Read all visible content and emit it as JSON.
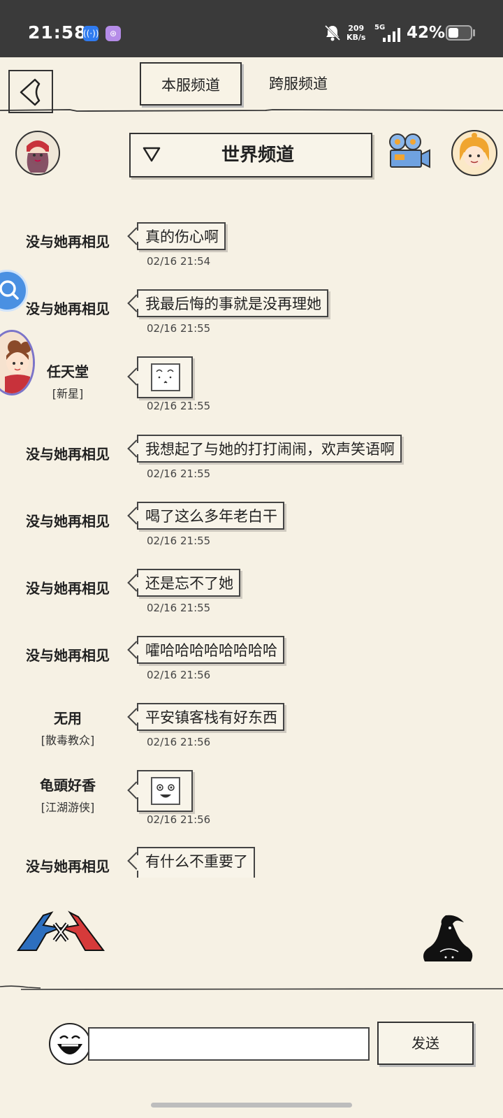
{
  "status_bar": {
    "time": "21:58",
    "net_speed_value": "209",
    "net_speed_unit": "KB/s",
    "network": "5G",
    "battery": "42%"
  },
  "tabs": [
    {
      "label": "本服频道",
      "active": true
    },
    {
      "label": "跨服频道",
      "active": false
    }
  ],
  "channel": {
    "label": "世界频道"
  },
  "messages": [
    {
      "sender": "没与她再相见",
      "title": "",
      "text": "真的伤心啊",
      "time": "02/16 21:54"
    },
    {
      "sender": "没与她再相见",
      "title": "",
      "text": "我最后悔的事就是没再理她",
      "time": "02/16 21:55"
    },
    {
      "sender": "任天堂",
      "title": "[新星]",
      "emoji": "face-1",
      "time": "02/16 21:55"
    },
    {
      "sender": "没与她再相见",
      "title": "",
      "text": "我想起了与她的打打闹闹，欢声笑语啊",
      "time": "02/16 21:55"
    },
    {
      "sender": "没与她再相见",
      "title": "",
      "text": "喝了这么多年老白干",
      "time": "02/16 21:55"
    },
    {
      "sender": "没与她再相见",
      "title": "",
      "text": "还是忘不了她",
      "time": "02/16 21:55"
    },
    {
      "sender": "没与她再相见",
      "title": "",
      "text": "嚯哈哈哈哈哈哈哈哈",
      "time": "02/16 21:56"
    },
    {
      "sender": "无用",
      "title": "[散毒教众]",
      "text": "平安镇客栈有好东西",
      "time": "02/16 21:56"
    },
    {
      "sender": "龟頭好香",
      "title": "[江湖游侠]",
      "emoji": "face-2",
      "time": "02/16 21:56"
    },
    {
      "sender": "没与她再相见",
      "title": "",
      "text": "有什么不重要了",
      "time": ""
    }
  ],
  "input": {
    "placeholder": "",
    "value": ""
  },
  "send_button": {
    "label": "发送"
  }
}
